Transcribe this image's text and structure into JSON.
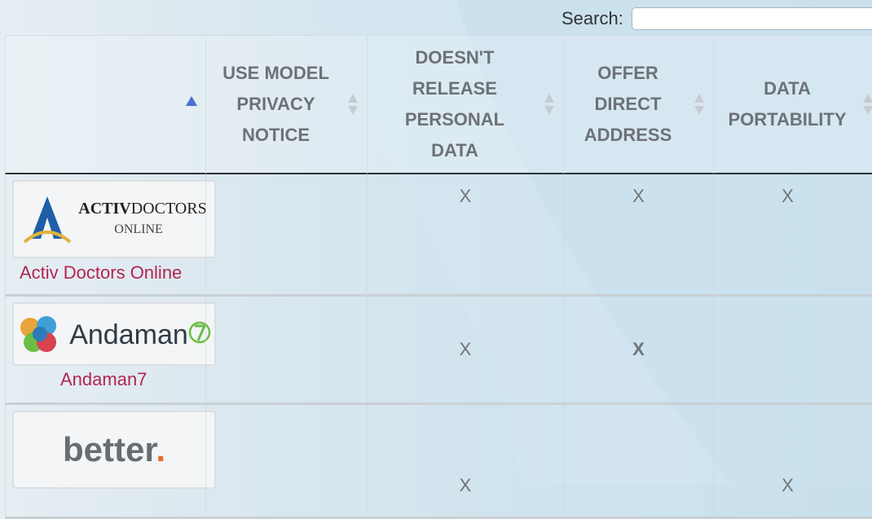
{
  "search": {
    "label": "Search:",
    "value": ""
  },
  "columns": [
    {
      "label": ""
    },
    {
      "label": "USE MODEL PRIVACY NOTICE"
    },
    {
      "label": "DOESN'T RELEASE PERSONAL DATA"
    },
    {
      "label": "OFFER DIRECT ADDRESS"
    },
    {
      "label": "DATA PORTABILITY"
    }
  ],
  "rows": [
    {
      "name": "Activ Doctors Online",
      "logo": {
        "brand_bold": "ACTIV",
        "brand_rest": "DOCTORS",
        "sub": "ONLINE"
      },
      "cells": [
        "",
        "X",
        "X",
        "X"
      ]
    },
    {
      "name": "Andaman7",
      "logo": {
        "brand": "Andaman"
      },
      "cells": [
        "",
        "X",
        "X",
        ""
      ]
    },
    {
      "name": "",
      "logo": {
        "brand": "better",
        "dot": "."
      },
      "cells": [
        "",
        "X",
        "",
        "X"
      ]
    }
  ],
  "colors": {
    "link": "#b3254f",
    "header_text": "#6d7276",
    "sort_active": "#4a6fd0"
  }
}
